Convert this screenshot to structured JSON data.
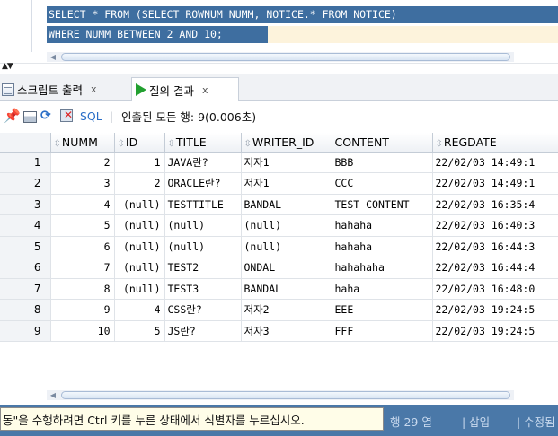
{
  "editor": {
    "line1": "SELECT * FROM (SELECT ROWNUM NUMM, NOTICE.* FROM NOTICE)",
    "line2": "WHERE NUMM BETWEEN 2 AND 10;"
  },
  "scroll_arrow": "◀",
  "splitter_arrows": "▲▼",
  "tabs": [
    {
      "label": "스크립트 출력",
      "close": "x"
    },
    {
      "label": "질의 결과",
      "close": "x"
    }
  ],
  "toolbar": {
    "pin_glyph": "📌",
    "refresh_glyph": "⟳",
    "sql_label": "SQL",
    "separator": "|",
    "fetch_text": "인출된 모든 행: 9(0.006초)"
  },
  "grid": {
    "sort_glyph": "⇳",
    "columns": [
      "NUMM",
      "ID",
      "TITLE",
      "WRITER_ID",
      "CONTENT",
      "REGDATE"
    ],
    "rows": [
      [
        "1",
        "2",
        "1",
        "JAVA란?",
        "저자1",
        "BBB",
        "22/02/03 14:49:1"
      ],
      [
        "2",
        "3",
        "2",
        "ORACLE란?",
        "저자1",
        "CCC",
        "22/02/03 14:49:1"
      ],
      [
        "3",
        "4",
        "(null)",
        "TESTTITLE",
        "BANDAL",
        "TEST CONTENT",
        "22/02/03 16:35:4"
      ],
      [
        "4",
        "5",
        "(null)",
        "(null)",
        "(null)",
        "hahaha",
        "22/02/03 16:40:3"
      ],
      [
        "5",
        "6",
        "(null)",
        "(null)",
        "(null)",
        "hahaha",
        "22/02/03 16:44:3"
      ],
      [
        "6",
        "7",
        "(null)",
        "TEST2",
        "ONDAL",
        "hahahaha",
        "22/02/03 16:44:4"
      ],
      [
        "7",
        "8",
        "(null)",
        "TEST3",
        "BANDAL",
        "haha",
        "22/02/03 16:48:0"
      ],
      [
        "8",
        "9",
        "4",
        "CSS란?",
        "저자2",
        "EEE",
        "22/02/03 19:24:5"
      ],
      [
        "9",
        "10",
        "5",
        "JS란?",
        "저자3",
        "FFF",
        "22/02/03 19:24:5"
      ]
    ]
  },
  "status": {
    "hint": "동\"을 수행하려면 Ctrl 키를 누른 상태에서 식별자를 누르십시오.",
    "position": "행 29 열",
    "mode": "| 삽입",
    "modified": "| 수정됨"
  },
  "colors": {
    "selection": "#3e6ea0",
    "status_bar": "#4a78a8",
    "run_icon": "#22a030",
    "link": "#2a6ec7"
  }
}
